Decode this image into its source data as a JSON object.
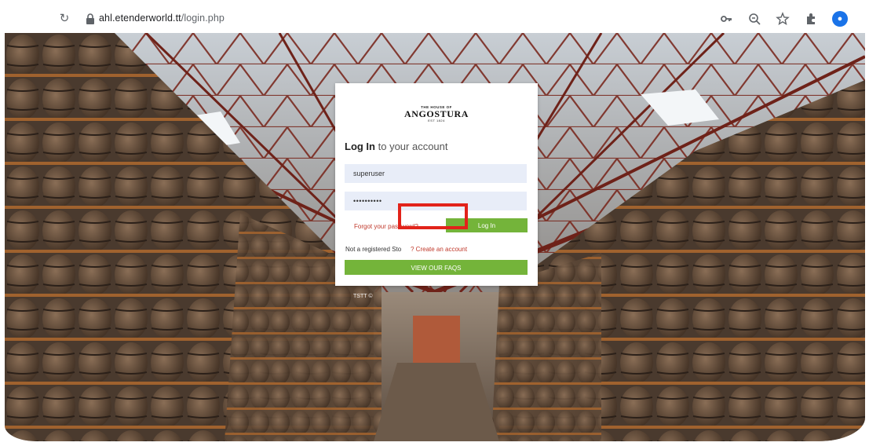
{
  "browser": {
    "url_host": "ahl.etenderworld.tt",
    "url_path": "/login.php"
  },
  "brand": {
    "top_line": "THE HOUSE OF",
    "name": "ANGOSTURA",
    "est": "EST 1824"
  },
  "login": {
    "heading_bold": "Log In",
    "heading_rest": " to your account",
    "username_value": "superuser",
    "password_value": "••••••••••",
    "forgot_label": "Forgot your password?",
    "login_label": "Log In",
    "not_registered": "Not a registered Sto",
    "create_account_label": "? Create an account",
    "faq_label": "VIEW OUR FAQS"
  },
  "footer": {
    "text": "TSTT ©"
  },
  "colors": {
    "accent_green": "#74b43a",
    "link_red": "#c0392b",
    "highlight_red": "#e2231a",
    "field_bg": "#e8edf8"
  }
}
